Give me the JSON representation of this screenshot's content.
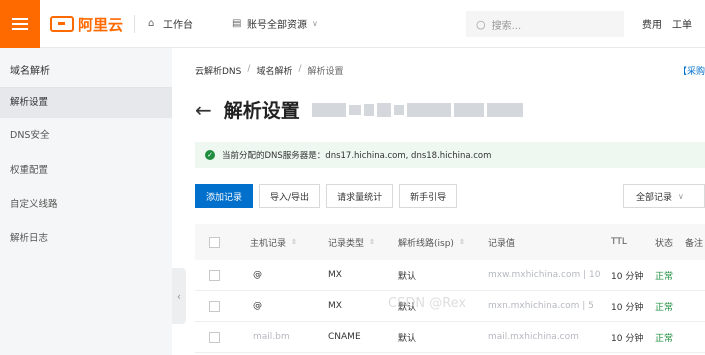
{
  "topbar": {
    "brand": "阿里云",
    "nav": [
      {
        "icon": "home-icon",
        "label": "工作台"
      },
      {
        "icon": "list-icon",
        "label": "账号全部资源"
      }
    ],
    "search_placeholder": "搜索...",
    "right": [
      "费用",
      "工单"
    ]
  },
  "sidebar": {
    "title": "域名解析",
    "items": [
      {
        "label": "解析设置",
        "active": true
      },
      {
        "label": "DNS安全",
        "active": false
      },
      {
        "label": "权重配置",
        "active": false
      },
      {
        "label": "自定义线路",
        "active": false
      },
      {
        "label": "解析日志",
        "active": false
      }
    ]
  },
  "breadcrumb": [
    "云解析DNS",
    "域名解析",
    "解析设置"
  ],
  "buy_link": "【采购",
  "page_title": "解析设置",
  "notice": "当前分配的DNS服务器是：dns17.hichina.com, dns18.hichina.com",
  "toolbar": {
    "buttons": [
      "添加记录",
      "导入/导出",
      "请求量统计",
      "新手引导"
    ],
    "filter": "全部记录"
  },
  "table": {
    "headers": [
      "主机记录",
      "记录类型",
      "解析线路(isp)",
      "记录值",
      "TTL",
      "状态",
      "备注"
    ],
    "rows": [
      {
        "host": "@",
        "type": "MX",
        "line": "默认",
        "value": "mxw.mxhichina.com | 10",
        "ttl": "10 分钟",
        "status": "正常"
      },
      {
        "host": "@",
        "type": "MX",
        "line": "默认",
        "value": "mxn.mxhichina.com | 5",
        "ttl": "10 分钟",
        "status": "正常"
      },
      {
        "host": "mail.bm",
        "type": "CNAME",
        "line": "默认",
        "value": "mail.mxhichina.com",
        "ttl": "10 分钟",
        "status": "正常"
      }
    ]
  },
  "watermark": "CSDN @Rex"
}
